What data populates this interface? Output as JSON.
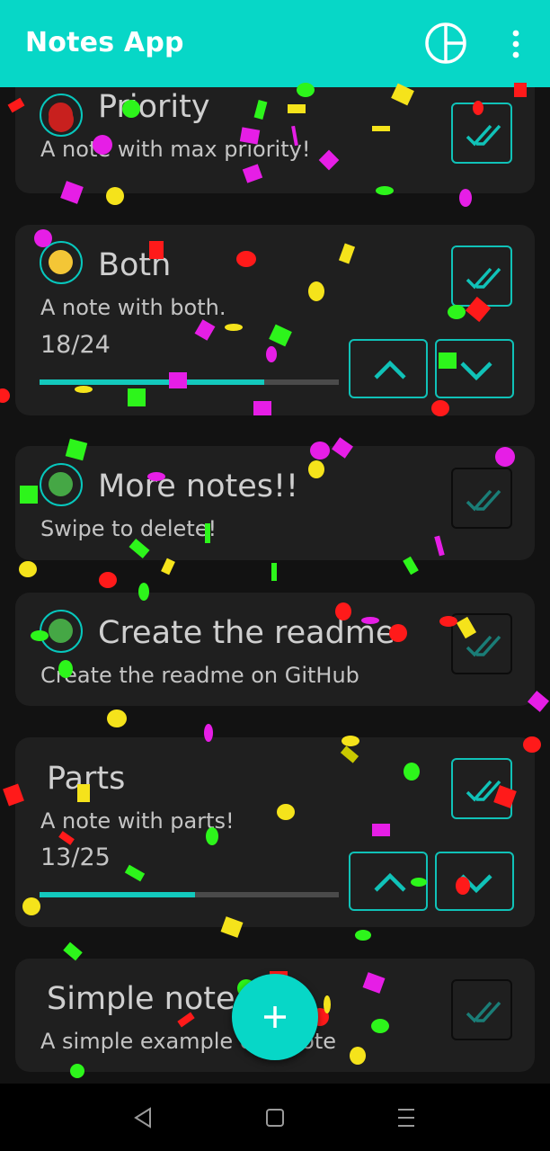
{
  "app": {
    "title": "Notes App",
    "accent": "#07d7c7",
    "chart_icon": "pie-chart-icon",
    "menu_icon": "more-vert-icon"
  },
  "notes": [
    {
      "title": "Priority",
      "description": "A note with max priority!",
      "priority_color": "#c8201e",
      "done": false
    },
    {
      "title": "Both",
      "description": "A note with both.",
      "priority_color": "#f4c636",
      "progress_text": "18/24",
      "progress_value": 0.75,
      "done": false
    },
    {
      "title": "More notes!!",
      "description": "Swipe to delete!",
      "priority_color": "#45a745",
      "done": false
    },
    {
      "title": "Create the readme",
      "description": "Create the readme on GitHub",
      "priority_color": "#45a745",
      "done": false
    },
    {
      "title": "Parts",
      "description": "A note with parts!",
      "progress_text": "13/25",
      "progress_value": 0.52,
      "done": false
    },
    {
      "title": "Simple note",
      "description": "A simple example of a note",
      "done": false
    }
  ],
  "fab": {
    "icon": "plus-icon"
  },
  "navigation": {
    "back_icon": "back-triangle-icon",
    "home_icon": "home-square-icon",
    "menu_icon": "menu-lines-icon"
  }
}
